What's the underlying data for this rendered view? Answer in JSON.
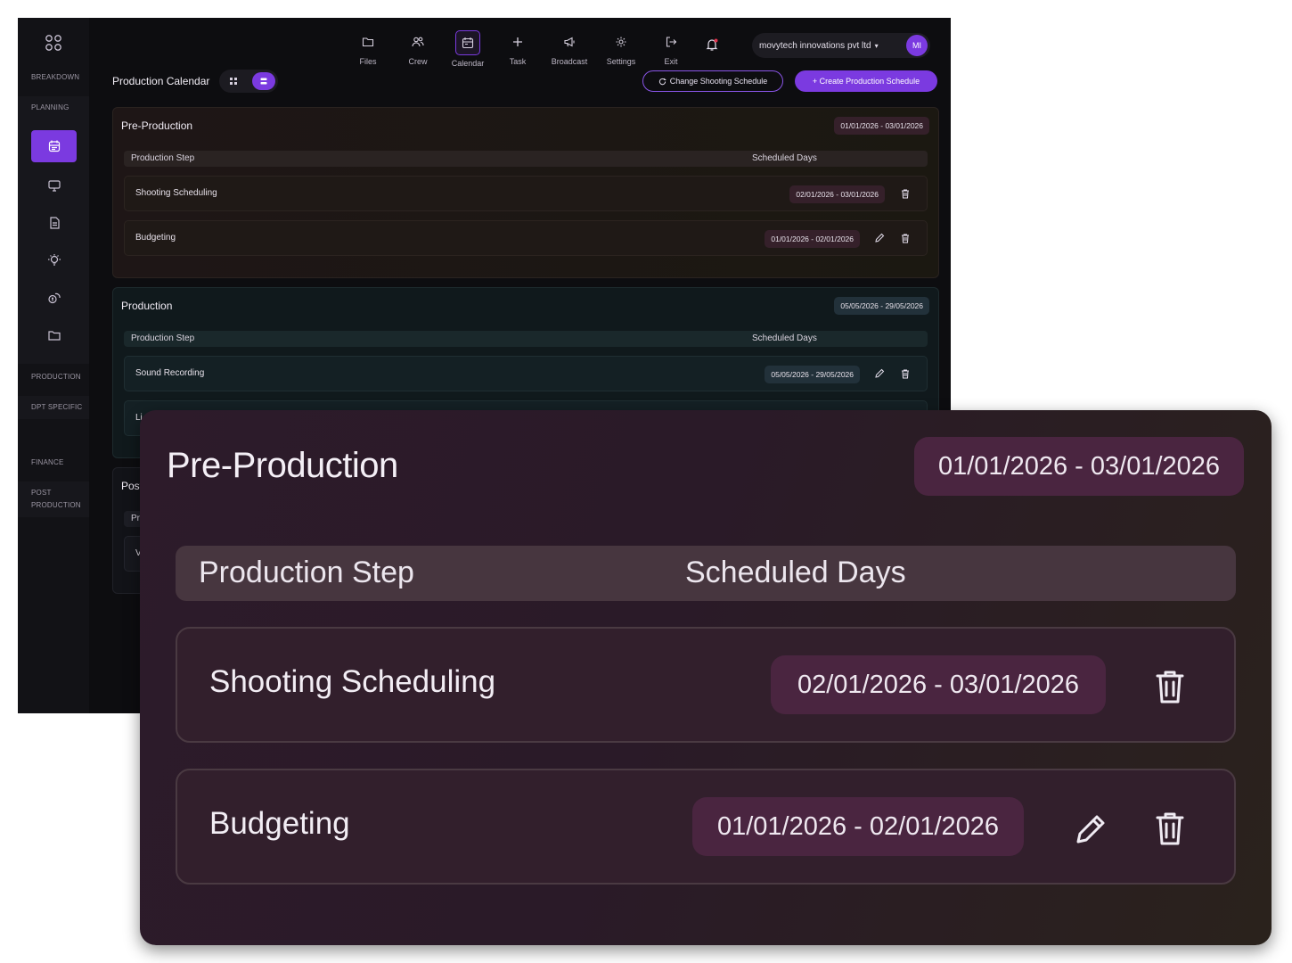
{
  "sidebar": {
    "sections": {
      "breakdown": "BREAKDOWN",
      "planning": "PLANNING",
      "production": "PRODUCTION",
      "dpt_specific": "DPT SPECIFIC",
      "finance": "FINANCE",
      "post_production": "POST PRODUCTION"
    },
    "planning_icons": [
      "calendar-icon",
      "monitor-icon",
      "document-icon",
      "lightbulb-icon",
      "money-icon",
      "folder-icon"
    ]
  },
  "topnav": {
    "items": [
      {
        "label": "Files",
        "icon": "folder-icon"
      },
      {
        "label": "Crew",
        "icon": "crew-icon"
      },
      {
        "label": "Calendar",
        "icon": "calendar-icon",
        "active": true
      },
      {
        "label": "Task",
        "icon": "plus-icon"
      },
      {
        "label": "Broadcast",
        "icon": "megaphone-icon"
      },
      {
        "label": "Settings",
        "icon": "gear-icon"
      },
      {
        "label": "Exit",
        "icon": "exit-icon"
      }
    ],
    "account_name": "movytech innovations pvt ltd",
    "avatar_initials": "MI"
  },
  "toolbar": {
    "title": "Production Calendar",
    "change_label": "Change Shooting Schedule",
    "create_label": "+ Create Production Schedule"
  },
  "phases": {
    "pre": {
      "title": "Pre-Production",
      "range": "01/01/2026 - 03/01/2026",
      "col_step": "Production Step",
      "col_days": "Scheduled Days",
      "rows": [
        {
          "name": "Shooting Scheduling",
          "range": "02/01/2026 - 03/01/2026",
          "editable": false
        },
        {
          "name": "Budgeting",
          "range": "01/01/2026 - 02/01/2026",
          "editable": true
        }
      ]
    },
    "production": {
      "title": "Production",
      "range": "05/05/2026 - 29/05/2026",
      "col_step": "Production Step",
      "col_days": "Scheduled Days",
      "rows": [
        {
          "name": "Sound Recording",
          "range": "05/05/2026 - 29/05/2026",
          "editable": true
        },
        {
          "name": "Li"
        }
      ]
    },
    "post": {
      "title": "Post",
      "col_step": "Pr",
      "rows": [
        {
          "name": "V"
        }
      ]
    }
  },
  "zoom": {
    "title": "Pre-Production",
    "range": "01/01/2026 - 03/01/2026",
    "col_step": "Production Step",
    "col_days": "Scheduled Days",
    "rows": [
      {
        "name": "Shooting Scheduling",
        "range": "02/01/2026 - 03/01/2026"
      },
      {
        "name": "Budgeting",
        "range": "01/01/2026 - 02/01/2026"
      }
    ]
  },
  "colors": {
    "accent": "#7b3ae0",
    "range_badge": "#4a2540"
  }
}
